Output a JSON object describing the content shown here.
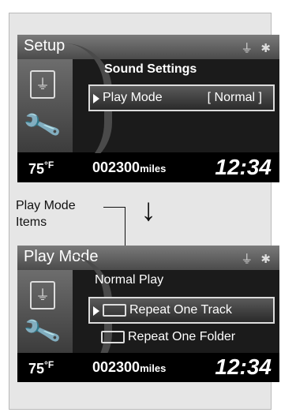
{
  "screen1": {
    "title": "Setup",
    "icons": "USB BT",
    "section": "Sound Settings",
    "row_label": "Play Mode",
    "row_value": "[ Normal ]"
  },
  "screen2": {
    "title": "Play Mode",
    "icons": "USB BT",
    "items": [
      "Normal Play",
      "Repeat One Track",
      "Repeat One Folder"
    ]
  },
  "status": {
    "temp": "75",
    "temp_unit": "°F",
    "odometer": "002300",
    "odometer_unit": "miles",
    "clock": "12:34"
  },
  "caption": {
    "line1": "Play Mode",
    "line2": "Items"
  },
  "arrow": "↓"
}
